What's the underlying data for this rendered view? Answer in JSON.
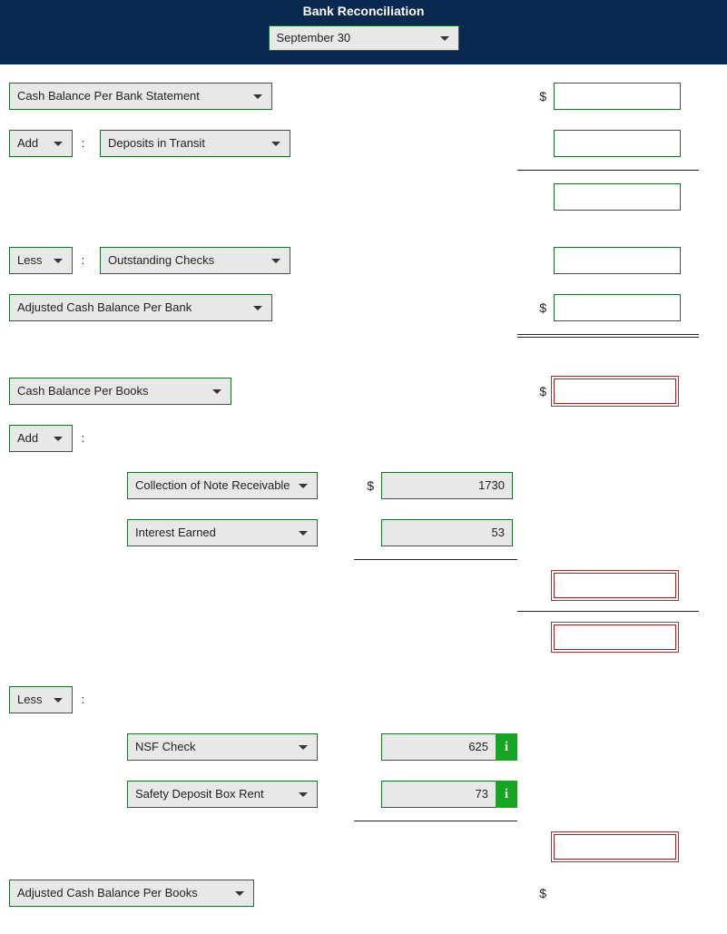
{
  "banner": {
    "title": "Bank Reconciliation",
    "date": "September 30"
  },
  "labels": {
    "cash_per_bank": "Cash Balance Per Bank Statement",
    "add": "Add",
    "less": "Less",
    "deposits_in_transit": "Deposits in Transit",
    "outstanding_checks": "Outstanding Checks",
    "adj_cash_per_bank": "Adjusted Cash Balance Per Bank",
    "cash_per_books": "Cash Balance Per Books",
    "collection_note": "Collection of Note Receivable",
    "interest_earned": "Interest Earned",
    "nsf_check": "NSF Check",
    "safety_deposit": "Safety Deposit Box Rent",
    "adj_cash_per_books": "Adjusted Cash Balance Per Books",
    "dollar": "$",
    "colon": ":",
    "info": "i"
  },
  "values": {
    "collection_note": "1730",
    "interest_earned": "53",
    "nsf_check": "625",
    "safety_deposit": "73"
  }
}
